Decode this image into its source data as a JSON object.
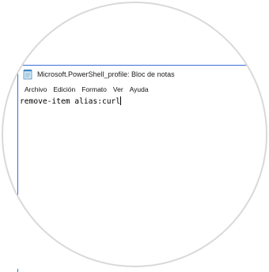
{
  "window": {
    "title": "Microsoft.PowerShell_profile: Bloc de notas",
    "icon": "notepad-icon"
  },
  "menu": {
    "items": [
      {
        "label": "Archivo"
      },
      {
        "label": "Edición"
      },
      {
        "label": "Formato"
      },
      {
        "label": "Ver"
      },
      {
        "label": "Ayuda"
      }
    ]
  },
  "editor": {
    "content": "remove-item alias:curl"
  },
  "colors": {
    "window_border": "#3a6fd8",
    "circle_frame": "#d9d9d9"
  }
}
